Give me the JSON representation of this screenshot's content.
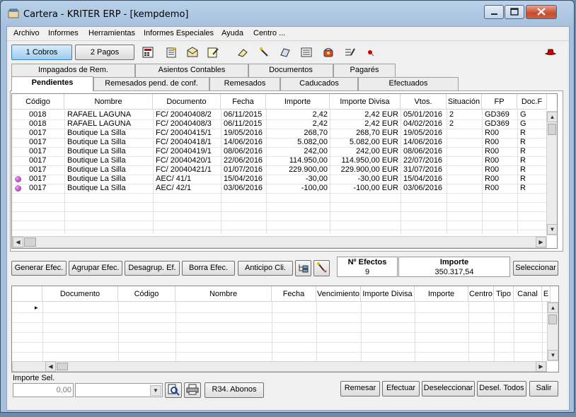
{
  "window": {
    "title": "Cartera - KRITER ERP - [kempdemo]",
    "accent": "#a5bfdc",
    "close_color": "#c74a2e"
  },
  "menu": [
    "Archivo",
    "Informes",
    "Herramientas",
    "Informes Especiales",
    "Ayuda",
    "Centro ..."
  ],
  "toolbar": {
    "cobros_label": "1 Cobros",
    "pagos_label": "2 Pagos",
    "icons": [
      "calculator-icon",
      "document-grid-icon",
      "mail-icon",
      "notepad-edit-icon",
      "eraser-icon",
      "wand-icon",
      "print-paper-icon",
      "form-icon",
      "alarm-phone-icon",
      "checklist-icon",
      "red-pin-icon",
      "hat-icon"
    ]
  },
  "tabs_row1": [
    "Impagados de Rem.",
    "Asientos Contables",
    "Documentos",
    "Pagarés"
  ],
  "tabs_row2": [
    "Pendientes",
    "Remesados pend. de conf.",
    "Remesados",
    "Caducados",
    "Efectuados"
  ],
  "top_grid": {
    "columns": [
      "Código",
      "Nombre",
      "Documento",
      "Fecha",
      "Importe",
      "Importe Divisa",
      "Vtos.",
      "Situación",
      "FP",
      "Doc.F"
    ],
    "rows": [
      {
        "marker": false,
        "codigo": "0018",
        "nombre": "RAFAEL LAGUNA",
        "documento": "FC/ 20040408/2",
        "fecha": "06/11/2015",
        "importe": "2,42",
        "divisa": "2,42 EUR",
        "vtos": "05/01/2016",
        "situacion": "2",
        "fp": "GD369",
        "docf": "G"
      },
      {
        "marker": false,
        "codigo": "0018",
        "nombre": "RAFAEL LAGUNA",
        "documento": "FC/ 20040408/3",
        "fecha": "06/11/2015",
        "importe": "2,42",
        "divisa": "2,42 EUR",
        "vtos": "04/02/2016",
        "situacion": "2",
        "fp": "GD369",
        "docf": "G"
      },
      {
        "marker": false,
        "codigo": "0017",
        "nombre": "Boutique La Silla",
        "documento": "FC/ 20040415/1",
        "fecha": "19/05/2016",
        "importe": "268,70",
        "divisa": "268,70 EUR",
        "vtos": "19/05/2016",
        "situacion": "",
        "fp": "R00",
        "docf": "R"
      },
      {
        "marker": false,
        "codigo": "0017",
        "nombre": "Boutique La Silla",
        "documento": "FC/ 20040418/1",
        "fecha": "14/06/2016",
        "importe": "5.082,00",
        "divisa": "5.082,00 EUR",
        "vtos": "14/06/2016",
        "situacion": "",
        "fp": "R00",
        "docf": "R"
      },
      {
        "marker": false,
        "codigo": "0017",
        "nombre": "Boutique La Silla",
        "documento": "FC/ 20040419/1",
        "fecha": "08/06/2016",
        "importe": "242,00",
        "divisa": "242,00 EUR",
        "vtos": "08/06/2016",
        "situacion": "",
        "fp": "R00",
        "docf": "R"
      },
      {
        "marker": false,
        "codigo": "0017",
        "nombre": "Boutique La Silla",
        "documento": "FC/ 20040420/1",
        "fecha": "22/06/2016",
        "importe": "114.950,00",
        "divisa": "114.950,00 EUR",
        "vtos": "22/07/2016",
        "situacion": "",
        "fp": "R00",
        "docf": "R"
      },
      {
        "marker": false,
        "codigo": "0017",
        "nombre": "Boutique La Silla",
        "documento": "FC/ 20040421/1",
        "fecha": "01/07/2016",
        "importe": "229.900,00",
        "divisa": "229.900,00 EUR",
        "vtos": "31/07/2016",
        "situacion": "",
        "fp": "R00",
        "docf": "R"
      },
      {
        "marker": true,
        "codigo": "0017",
        "nombre": "Boutique La Silla",
        "documento": "AEC/ 41/1",
        "fecha": "15/04/2016",
        "importe": "-30,00",
        "divisa": "-30,00 EUR",
        "vtos": "15/04/2016",
        "situacion": "",
        "fp": "R00",
        "docf": "R"
      },
      {
        "marker": true,
        "codigo": "0017",
        "nombre": "Boutique La Silla",
        "documento": "AEC/ 42/1",
        "fecha": "03/06/2016",
        "importe": "-100,00",
        "divisa": "-100,00 EUR",
        "vtos": "03/06/2016",
        "situacion": "",
        "fp": "R00",
        "docf": "R"
      }
    ]
  },
  "actions": {
    "generar": "Generar Efec.",
    "agrupar": "Agrupar Efec.",
    "desagrupar": "Desagrup. Ef.",
    "borra": "Borra Efec.",
    "anticipo": "Anticipo Cli.",
    "seleccionar": "Seleccionar"
  },
  "summary": {
    "efectos_label": "Nº Efectos",
    "efectos_value": "9",
    "importe_label": "Importe",
    "importe_value": "350.317,54"
  },
  "bottom_grid": {
    "columns": [
      "Documento",
      "Código",
      "Nombre",
      "Fecha",
      "Vencimiento",
      "Importe Divisa",
      "Importe",
      "Centro",
      "Tipo",
      "Canal",
      "E"
    ]
  },
  "footer": {
    "importe_sel_label": "Importe Sel.",
    "importe_sel_value": "0,00",
    "r34_label": "R34. Abonos",
    "remesar": "Remesar",
    "efectuar": "Efectuar",
    "deseleccionar": "Deseleccionar",
    "desel_todos": "Desel. Todos",
    "salir": "Salir"
  }
}
